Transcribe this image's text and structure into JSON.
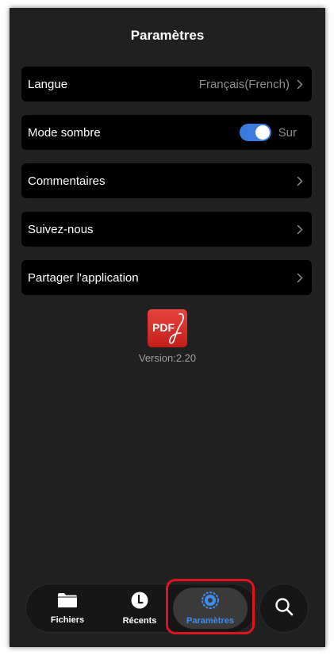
{
  "header": {
    "title": "Paramètres"
  },
  "settings": {
    "language": {
      "label": "Langue",
      "value": "Français(French)"
    },
    "dark_mode": {
      "label": "Mode sombre",
      "state": "Sur",
      "enabled": true
    },
    "feedback": {
      "label": "Commentaires"
    },
    "follow": {
      "label": "Suivez-nous"
    },
    "share": {
      "label": "Partager l'application"
    }
  },
  "app": {
    "logo_text": "PDF",
    "version": "Version:2.20"
  },
  "tabbar": {
    "files": "Fichiers",
    "recent": "Récents",
    "settings": "Paramètres",
    "active": "settings"
  },
  "colors": {
    "background": "#202020",
    "row": "#000000",
    "accent": "#3a7be0",
    "active_tab_label": "#3f8cf0",
    "highlight": "#e0141e",
    "logo_red": "#d8302c"
  },
  "icons": [
    "chevron-right-icon",
    "folder-icon",
    "clock-icon",
    "gear-icon",
    "search-icon",
    "pdf-logo-icon"
  ]
}
